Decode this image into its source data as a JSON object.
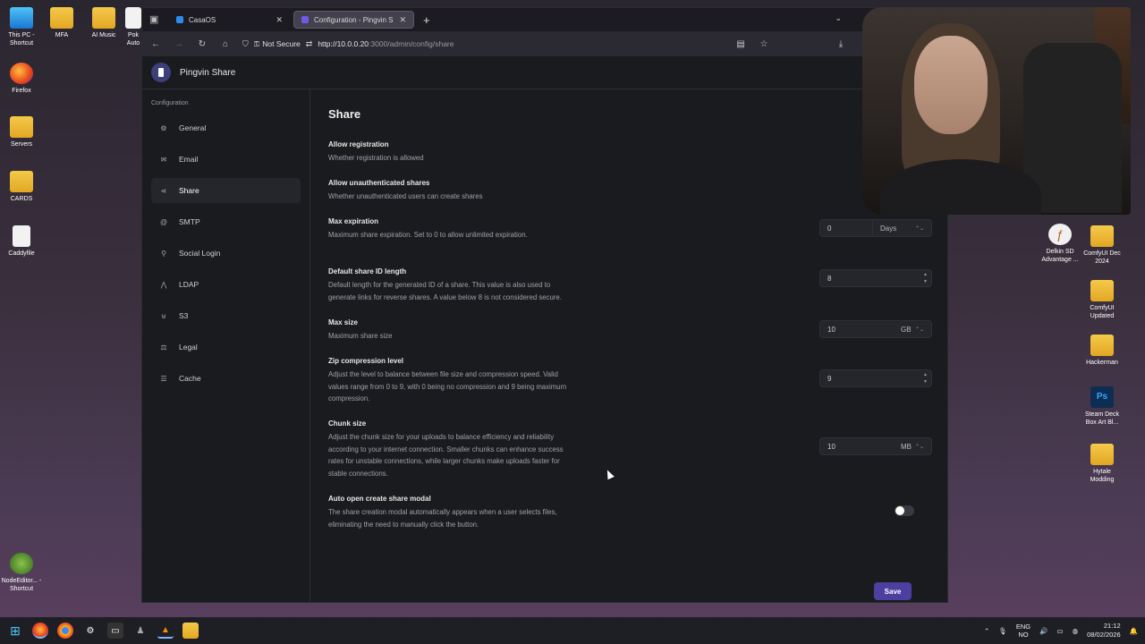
{
  "desktop": {
    "left_icons": [
      {
        "label": "This PC - Shortcut",
        "icon": "pc-icon"
      },
      {
        "label": "Firefox",
        "icon": "firefox-icon"
      },
      {
        "label": "Servers",
        "icon": "folder-icon"
      },
      {
        "label": "CARDS",
        "icon": "folder-icon"
      },
      {
        "label": "Caddyfile",
        "icon": "document-icon"
      },
      {
        "label": "NodeEditor... - Shortcut",
        "icon": "lime-icon"
      }
    ],
    "top_icons": [
      {
        "label": "MFA",
        "icon": "folder-icon"
      },
      {
        "label": "AI Music",
        "icon": "folder-icon"
      },
      {
        "label": "Pok Auto",
        "icon": "app-icon"
      }
    ],
    "right_icons": [
      {
        "label": "Delkin SD Advantage ...",
        "icon": "extension-icon"
      },
      {
        "label": "ComfyUI Dec 2024",
        "icon": "folder-icon"
      },
      {
        "label": "ComfyUI Updated",
        "icon": "folder-icon"
      },
      {
        "label": "Hackerman",
        "icon": "folder-icon"
      },
      {
        "label": "Steam Deck Box Art Bl...",
        "icon": "photoshop-icon"
      },
      {
        "label": "Hytale Modding",
        "icon": "folder-icon"
      }
    ]
  },
  "browser": {
    "tabs": [
      {
        "label": "CasaOS",
        "active": false
      },
      {
        "label": "Configuration - Pingvin Share",
        "active": true
      }
    ],
    "new_tab": "+",
    "security_label": "Not Secure",
    "url_host": "http://10.0.0.20",
    "url_rest": ":3000/admin/config/share"
  },
  "app": {
    "name": "Pingvin Share",
    "sidebar_section": "Configuration",
    "sidebar_items": [
      {
        "label": "General",
        "icon": "gear-icon"
      },
      {
        "label": "Email",
        "icon": "mail-icon"
      },
      {
        "label": "Share",
        "icon": "share-icon",
        "active": true
      },
      {
        "label": "SMTP",
        "icon": "at-icon"
      },
      {
        "label": "Social Login",
        "icon": "user-icon"
      },
      {
        "label": "LDAP",
        "icon": "ldap-icon"
      },
      {
        "label": "S3",
        "icon": "bucket-icon"
      },
      {
        "label": "Legal",
        "icon": "scale-icon"
      },
      {
        "label": "Cache",
        "icon": "database-icon"
      }
    ],
    "page_title": "Share",
    "settings": [
      {
        "name": "Allow registration",
        "desc": "Whether registration is allowed"
      },
      {
        "name": "Allow unauthenticated shares",
        "desc": "Whether unauthenticated users can create shares"
      },
      {
        "name": "Max expiration",
        "desc": "Maximum share expiration. Set to 0 to allow unlimited expiration.",
        "value": "0",
        "unit": "Days"
      },
      {
        "name": "Default share ID length",
        "desc": "Default length for the generated ID of a share. This value is also used to generate links for reverse shares. A value below 8 is not considered secure.",
        "value": "8"
      },
      {
        "name": "Max size",
        "desc": "Maximum share size",
        "value": "10",
        "unit": "GB"
      },
      {
        "name": "Zip compression level",
        "desc": "Adjust the level to balance between file size and compression speed. Valid values range from 0 to 9, with 0 being no compression and 9 being maximum compression.",
        "value": "9"
      },
      {
        "name": "Chunk size",
        "desc": "Adjust the chunk size for your uploads to balance efficiency and reliability according to your internet connection. Smaller chunks can enhance success rates for unstable connections, while larger chunks make uploads faster for stable connections.",
        "value": "10",
        "unit": "MB"
      },
      {
        "name": "Auto open create share modal",
        "desc": "The share creation modal automatically appears when a user selects files, eliminating the need to manually click the button.",
        "toggle": false
      }
    ],
    "save_label": "Save"
  },
  "taskbar": {
    "lang_line1": "ENG",
    "lang_line2": "NO",
    "time": "21:12",
    "date": "08/02/2026"
  }
}
